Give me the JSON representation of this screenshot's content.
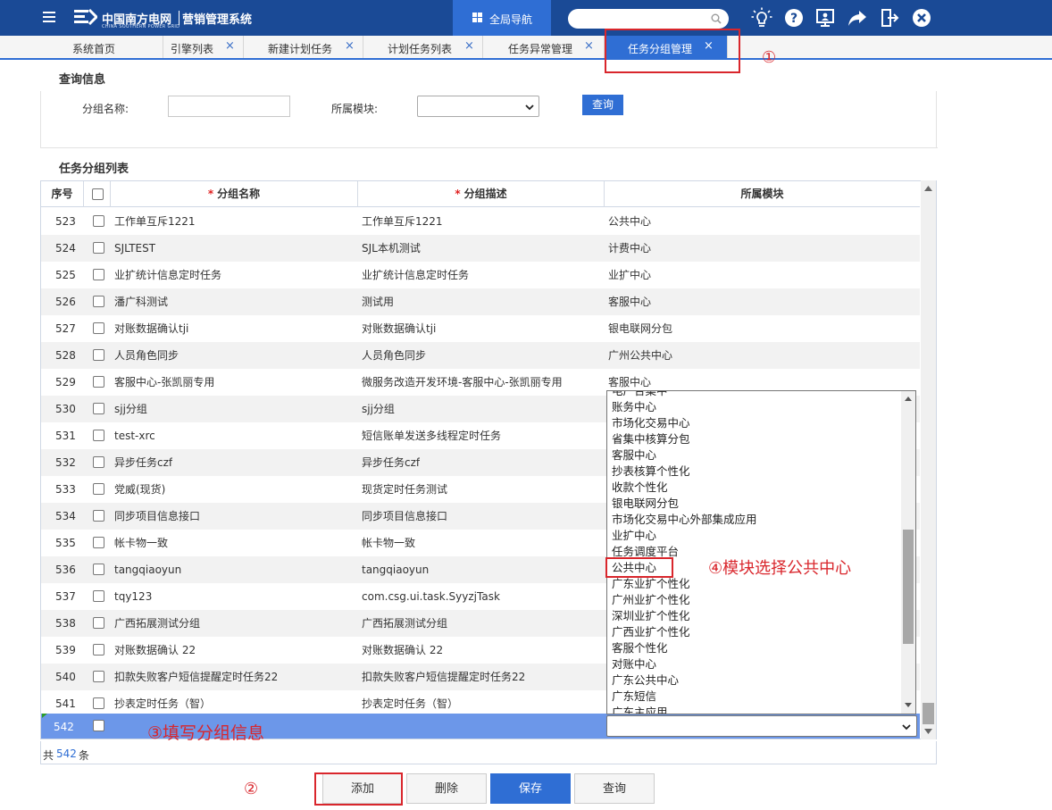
{
  "header": {
    "logo_name": "中国南方电网",
    "logo_sub": "CHINA SOUTHERN POWER GRID",
    "system_title": "营销管理系统",
    "global_nav_label": "全局导航",
    "search_placeholder": ""
  },
  "tabs": [
    {
      "label": "系统首页",
      "closable": false
    },
    {
      "label": "引擎列表",
      "closable": true
    },
    {
      "label": "新建计划任务",
      "closable": true
    },
    {
      "label": "计划任务列表",
      "closable": true
    },
    {
      "label": "任务异常管理",
      "closable": true
    },
    {
      "label": "任务分组管理",
      "closable": true,
      "active": true
    }
  ],
  "close_glyph": "×",
  "query": {
    "section_title": "查询信息",
    "group_name_label": "分组名称:",
    "group_name_value": "",
    "module_label": "所属模块:",
    "module_value": "",
    "query_button": "查询"
  },
  "list": {
    "section_title": "任务分组列表",
    "columns": {
      "index": "序号",
      "name": "分组名称",
      "desc": "分组描述",
      "module": "所属模块",
      "required_mark": "*"
    },
    "rows": [
      {
        "no": "523",
        "name": "工作单互斥1221",
        "desc": "工作单互斥1221",
        "module": "公共中心"
      },
      {
        "no": "524",
        "name": "SJLTEST",
        "desc": "SJL本机测试",
        "module": "计费中心"
      },
      {
        "no": "525",
        "name": "业扩统计信息定时任务",
        "desc": "业扩统计信息定时任务",
        "module": "业扩中心"
      },
      {
        "no": "526",
        "name": "潘广科测试",
        "desc": "测试用",
        "module": "客服中心"
      },
      {
        "no": "527",
        "name": "对账数据确认tji",
        "desc": "对账数据确认tji",
        "module": "银电联网分包"
      },
      {
        "no": "528",
        "name": "人员角色同步",
        "desc": "人员角色同步",
        "module": "广州公共中心"
      },
      {
        "no": "529",
        "name": "客服中心-张凯丽专用",
        "desc": "微服务改造开发环境-客服中心-张凯丽专用",
        "module": "客服中心"
      },
      {
        "no": "530",
        "name": "sjj分组",
        "desc": "sjj分组",
        "module": ""
      },
      {
        "no": "531",
        "name": "test-xrc",
        "desc": "短信账单发送多线程定时任务",
        "module": ""
      },
      {
        "no": "532",
        "name": "异步任务czf",
        "desc": "异步任务czf",
        "module": ""
      },
      {
        "no": "533",
        "name": "党威(现货)",
        "desc": "现货定时任务测试",
        "module": ""
      },
      {
        "no": "534",
        "name": "同步项目信息接口",
        "desc": "同步项目信息接口",
        "module": ""
      },
      {
        "no": "535",
        "name": "帐卡物一致",
        "desc": "帐卡物一致",
        "module": ""
      },
      {
        "no": "536",
        "name": "tangqiaoyun",
        "desc": "tangqiaoyun",
        "module": ""
      },
      {
        "no": "537",
        "name": "tqy123",
        "desc": "com.csg.ui.task.SyyzjTask",
        "module": ""
      },
      {
        "no": "538",
        "name": "广西拓展测试分组",
        "desc": "广西拓展测试分组",
        "module": ""
      },
      {
        "no": "539",
        "name": "对账数据确认 22",
        "desc": "对账数据确认 22",
        "module": ""
      },
      {
        "no": "540",
        "name": "扣款失败客户短信提醒定时任务22",
        "desc": "扣款失败客户短信提醒定时任务22",
        "module": ""
      },
      {
        "no": "541",
        "name": "抄表定时任务（智）",
        "desc": "抄表定时任务（智）",
        "module": ""
      }
    ],
    "new_row_no": "542",
    "total_prefix": "共",
    "total_count": "542",
    "total_suffix": "条"
  },
  "module_dropdown": {
    "partial_top": "电厂合集中",
    "options": [
      "账务中心",
      "市场化交易中心",
      "省集中核算分包",
      "客服中心",
      "抄表核算个性化",
      "收款个性化",
      "银电联网分包",
      "市场化交易中心外部集成应用",
      "业扩中心",
      "任务调度平台",
      "公共中心",
      "广东业扩个性化",
      "广州业扩个性化",
      "深圳业扩个性化",
      "广西业扩个性化",
      "客服个性化",
      "对账中心",
      "广东公共中心",
      "广东短信",
      "广东主应用"
    ],
    "highlighted": "公共中心"
  },
  "buttons": {
    "add": "添加",
    "delete": "删除",
    "save": "保存",
    "query": "查询"
  },
  "annotations": {
    "step1": "①",
    "step2": "②",
    "step3": "③填写分组信息",
    "step4": "④模块选择公共中心"
  },
  "colors": {
    "header_bg": "#1a4a96",
    "accent": "#2f6ed4",
    "annotation_red": "#d9262c",
    "selected_row": "#6c97e9"
  }
}
